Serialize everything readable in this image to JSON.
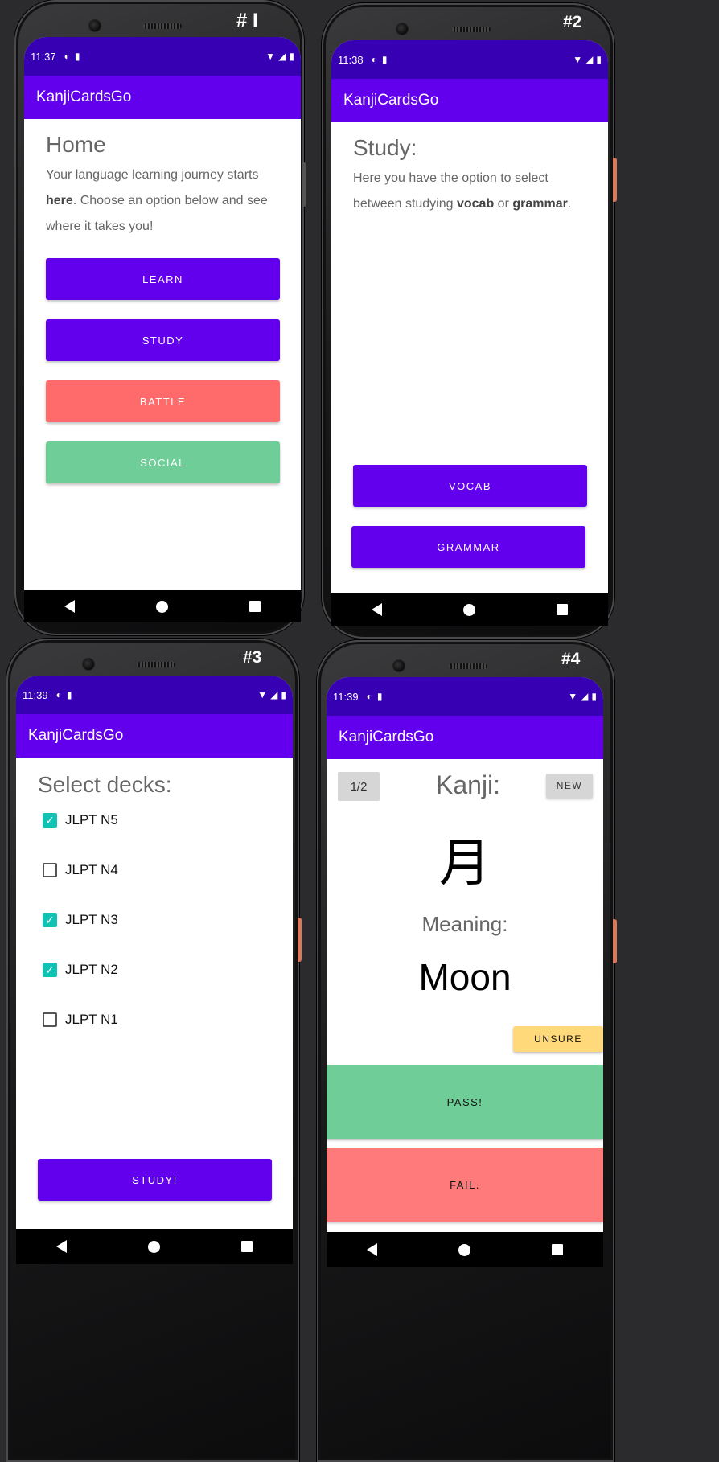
{
  "app_title": "KanjiCardsGo",
  "colors": {
    "primary": "#6200ee",
    "primary_dark": "#3700b3",
    "battle": "#ff6b6b",
    "social": "#6fcd97",
    "unsure": "#ffd97a",
    "check": "#10c2b4"
  },
  "phones": {
    "p1": {
      "label": "# I",
      "time": "11:37",
      "heading": "Home",
      "body_pre": "Your language learning journey starts ",
      "body_bold": "here",
      "body_post": ". Choose an option below and see where it takes you!",
      "buttons": {
        "learn": "LEARN",
        "study": "STUDY",
        "battle": "BATTLE",
        "social": "SOCIAL"
      }
    },
    "p2": {
      "label": "#2",
      "time": "11:38",
      "heading": "Study:",
      "body_pre": "Here you have the option to select between studying ",
      "body_bold1": "vocab",
      "body_mid": " or ",
      "body_bold2": "grammar",
      "body_post": ".",
      "buttons": {
        "vocab": "VOCAB",
        "grammar": "GRAMMAR"
      }
    },
    "p3": {
      "label": "#3",
      "time": "11:39",
      "heading": "Select decks:",
      "decks": [
        {
          "label": "JLPT N5",
          "checked": true
        },
        {
          "label": "JLPT N4",
          "checked": false
        },
        {
          "label": "JLPT N3",
          "checked": true
        },
        {
          "label": "JLPT N2",
          "checked": true
        },
        {
          "label": "JLPT N1",
          "checked": false
        }
      ],
      "check_mark": "✓",
      "study_button": "STUDY!"
    },
    "p4": {
      "label": "#4",
      "time": "11:39",
      "counter": "1/2",
      "new_button": "NEW",
      "kanji_label": "Kanji:",
      "kanji": "月",
      "meaning_label": "Meaning:",
      "meaning": "Moon",
      "unsure_button": "UNSURE",
      "pass_button": "PASS!",
      "fail_button": "FAIL."
    }
  }
}
